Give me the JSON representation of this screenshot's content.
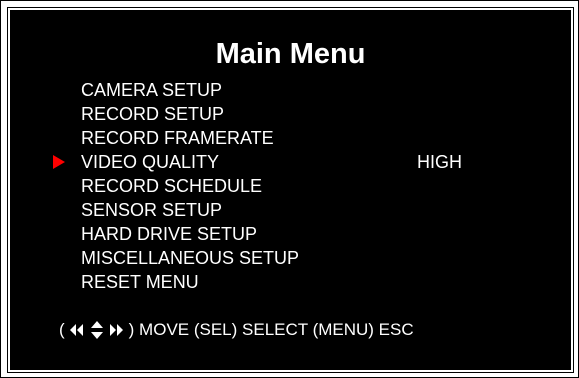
{
  "title": "Main Menu",
  "menu": [
    {
      "label": "CAMERA SETUP",
      "value": ""
    },
    {
      "label": "RECORD SETUP",
      "value": ""
    },
    {
      "label": "RECORD FRAMERATE",
      "value": ""
    },
    {
      "label": "VIDEO QUALITY",
      "value": "HIGH",
      "selected": true
    },
    {
      "label": "RECORD SCHEDULE",
      "value": ""
    },
    {
      "label": "SENSOR SETUP",
      "value": ""
    },
    {
      "label": "HARD DRIVE SETUP",
      "value": ""
    },
    {
      "label": "MISCELLANEOUS SETUP",
      "value": ""
    },
    {
      "label": "RESET MENU",
      "value": ""
    }
  ],
  "hint": {
    "open_paren": "(",
    "move_text": ") MOVE (SEL) SELECT (MENU) ESC"
  },
  "colors": {
    "background": "#000000",
    "text": "#ffffff",
    "cursor": "#ff0000"
  },
  "icons": {
    "cursor": "selection-arrow-icon",
    "navigation": "navigation-arrows-icon"
  }
}
